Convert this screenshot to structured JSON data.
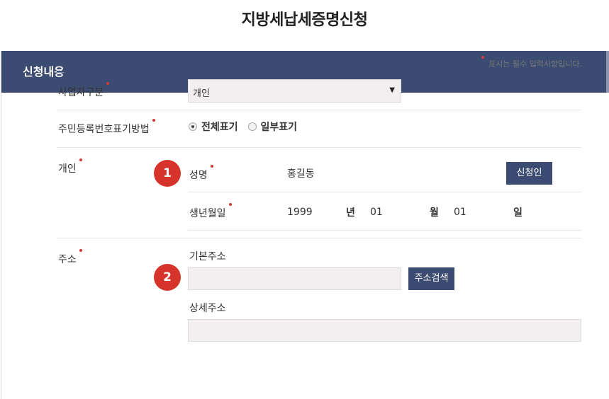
{
  "page_title": "지방세납세증명신청",
  "panel_title": "신청내용",
  "required_note": "표시는 필수 입력사항입니다.",
  "fields": {
    "business_type": {
      "label": "사업자구분",
      "selected": "개인"
    },
    "rrn_display": {
      "label": "주민등록번호표기방법",
      "options": [
        {
          "label": "전체표기",
          "checked": true
        },
        {
          "label": "일부표기",
          "checked": false
        }
      ]
    },
    "individual": {
      "label": "개인",
      "step": "1",
      "name_label": "성명",
      "name_value": "홍길동",
      "applicant_button": "신청인",
      "birth_label": "생년월일",
      "year": "1999",
      "year_unit": "년",
      "month": "01",
      "month_unit": "월",
      "day": "01",
      "day_unit": "일"
    },
    "address": {
      "label": "주소",
      "step": "2",
      "basic_label": "기본주소",
      "basic_value": "",
      "search_button": "주소검색",
      "detail_label": "상세주소",
      "detail_value": ""
    }
  },
  "colors": {
    "header_bg": "#3c4b72",
    "accent_red": "#d6332b",
    "input_bg": "#f3eff1"
  }
}
